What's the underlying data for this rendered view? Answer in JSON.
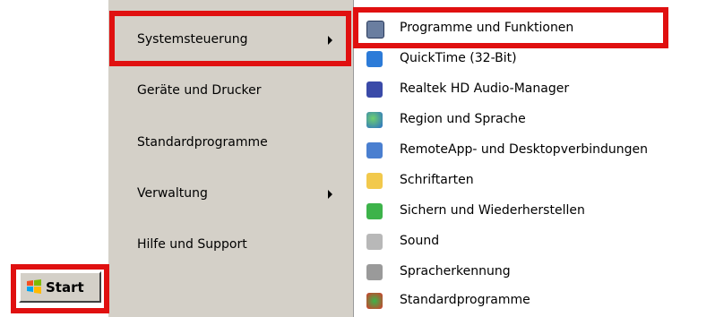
{
  "start_menu": {
    "items": [
      {
        "label": "Systemsteuerung",
        "has_submenu": true
      },
      {
        "label": "Geräte und Drucker",
        "has_submenu": false
      },
      {
        "label": "Standardprogramme",
        "has_submenu": false
      },
      {
        "label": "Verwaltung",
        "has_submenu": true
      },
      {
        "label": "Hilfe und Support",
        "has_submenu": false
      }
    ]
  },
  "submenu": {
    "items": [
      {
        "label": "Programme und Funktionen",
        "icon": "programs-icon"
      },
      {
        "label": "QuickTime (32-Bit)",
        "icon": "quicktime-icon"
      },
      {
        "label": "Realtek HD Audio-Manager",
        "icon": "realtek-audio-icon"
      },
      {
        "label": "Region und Sprache",
        "icon": "globe-icon"
      },
      {
        "label": "RemoteApp- und Desktopverbindungen",
        "icon": "remote-desktop-icon"
      },
      {
        "label": "Schriftarten",
        "icon": "fonts-icon"
      },
      {
        "label": "Sichern und Wiederherstellen",
        "icon": "backup-icon"
      },
      {
        "label": "Sound",
        "icon": "speaker-icon"
      },
      {
        "label": "Spracherkennung",
        "icon": "microphone-icon"
      },
      {
        "label": "Standardprogramme",
        "icon": "default-programs-icon"
      }
    ]
  },
  "taskbar": {
    "start_label": "Start"
  },
  "colors": {
    "highlight": "#e01010",
    "menu_bg": "#d4d0c8"
  }
}
